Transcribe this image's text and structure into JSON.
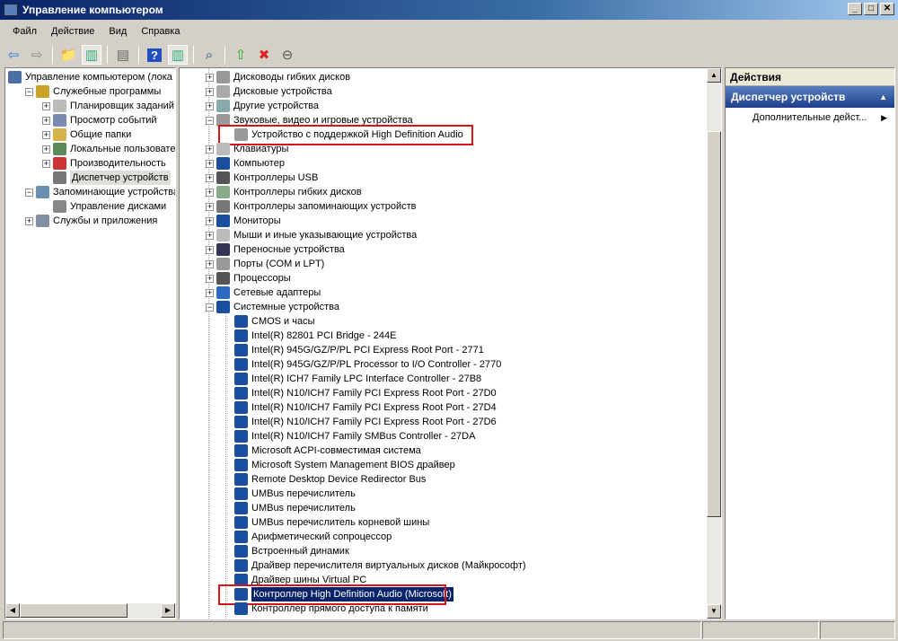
{
  "window": {
    "title": "Управление компьютером",
    "min": "_",
    "max": "□",
    "close": "✕"
  },
  "menu": [
    "Файл",
    "Действие",
    "Вид",
    "Справка"
  ],
  "toolbar": [
    {
      "icon": "back-icon",
      "glyph": "⇦",
      "color": "#2a7de1"
    },
    {
      "icon": "forward-icon",
      "glyph": "⇨",
      "color": "#888"
    },
    {
      "sep": true
    },
    {
      "icon": "up-folder-icon",
      "glyph": "📁",
      "color": "#c9a227"
    },
    {
      "icon": "show-hide-tree-icon",
      "glyph": "▥",
      "color": "#3a7",
      "on": true
    },
    {
      "sep": true
    },
    {
      "icon": "properties-icon",
      "glyph": "▤",
      "color": "#666"
    },
    {
      "sep": true
    },
    {
      "icon": "help-icon",
      "glyph": "?",
      "color": "#fff",
      "bg": "#2050c0"
    },
    {
      "icon": "show-hide-action-pane-icon",
      "glyph": "▥",
      "color": "#3a7",
      "on": true
    },
    {
      "sep": true
    },
    {
      "icon": "scan-hardware-icon",
      "glyph": "⌕",
      "color": "#246"
    },
    {
      "sep": true
    },
    {
      "icon": "update-driver-icon",
      "glyph": "⇧",
      "color": "#2a2"
    },
    {
      "icon": "uninstall-icon",
      "glyph": "✖",
      "color": "#d22"
    },
    {
      "icon": "disable-icon",
      "glyph": "⊖",
      "color": "#555"
    }
  ],
  "left_tree": [
    {
      "level": 0,
      "exp": "",
      "label": "Управление компьютером (лока",
      "color": "#4a6fa5"
    },
    {
      "level": 1,
      "exp": "−",
      "label": "Служебные программы",
      "color": "#c9a227"
    },
    {
      "level": 2,
      "exp": "+",
      "label": "Планировщик заданий",
      "color": "#bbb"
    },
    {
      "level": 2,
      "exp": "+",
      "label": "Просмотр событий",
      "color": "#7a8ab0"
    },
    {
      "level": 2,
      "exp": "+",
      "label": "Общие папки",
      "color": "#d8b24a"
    },
    {
      "level": 2,
      "exp": "+",
      "label": "Локальные пользовател",
      "color": "#5a8a5a"
    },
    {
      "level": 2,
      "exp": "+",
      "label": "Производительность",
      "color": "#c33"
    },
    {
      "level": 2,
      "exp": "",
      "label": "Диспетчер устройств",
      "color": "#777",
      "hl": true
    },
    {
      "level": 1,
      "exp": "−",
      "label": "Запоминающие устройства",
      "color": "#6a8fb0"
    },
    {
      "level": 2,
      "exp": "",
      "label": "Управление дисками",
      "color": "#888"
    },
    {
      "level": 1,
      "exp": "+",
      "label": "Службы и приложения",
      "color": "#8090a0"
    }
  ],
  "device_tree": [
    {
      "level": 1,
      "exp": "+",
      "label": "Дисководы гибких дисков",
      "color": "#999"
    },
    {
      "level": 1,
      "exp": "+",
      "label": "Дисковые устройства",
      "color": "#aaa"
    },
    {
      "level": 1,
      "exp": "+",
      "label": "Другие устройства",
      "color": "#8aa"
    },
    {
      "level": 1,
      "exp": "−",
      "label": "Звуковые, видео и игровые устройства",
      "color": "#999"
    },
    {
      "level": 2,
      "exp": "",
      "label": "Устройство с поддержкой High Definition Audio",
      "color": "#999",
      "boxed": true
    },
    {
      "level": 1,
      "exp": "+",
      "label": "Клавиатуры",
      "color": "#bbb"
    },
    {
      "level": 1,
      "exp": "+",
      "label": "Компьютер",
      "color": "#1a4fa0"
    },
    {
      "level": 1,
      "exp": "+",
      "label": "Контроллеры USB",
      "color": "#555"
    },
    {
      "level": 1,
      "exp": "+",
      "label": "Контроллеры гибких дисков",
      "color": "#8a8"
    },
    {
      "level": 1,
      "exp": "+",
      "label": "Контроллеры запоминающих устройств",
      "color": "#777"
    },
    {
      "level": 1,
      "exp": "+",
      "label": "Мониторы",
      "color": "#1a4fa0"
    },
    {
      "level": 1,
      "exp": "+",
      "label": "Мыши и иные указывающие устройства",
      "color": "#bbb"
    },
    {
      "level": 1,
      "exp": "+",
      "label": "Переносные устройства",
      "color": "#335"
    },
    {
      "level": 1,
      "exp": "+",
      "label": "Порты (COM и LPT)",
      "color": "#999"
    },
    {
      "level": 1,
      "exp": "+",
      "label": "Процессоры",
      "color": "#555"
    },
    {
      "level": 1,
      "exp": "+",
      "label": "Сетевые адаптеры",
      "color": "#2a6ac0"
    },
    {
      "level": 1,
      "exp": "−",
      "label": "Системные устройства",
      "color": "#1a4fa0"
    },
    {
      "level": 2,
      "exp": "",
      "label": "CMOS и часы",
      "color": "#1a4fa0"
    },
    {
      "level": 2,
      "exp": "",
      "label": "Intel(R) 82801 PCI Bridge - 244E",
      "color": "#1a4fa0"
    },
    {
      "level": 2,
      "exp": "",
      "label": "Intel(R) 945G/GZ/P/PL PCI Express Root Port - 2771",
      "color": "#1a4fa0"
    },
    {
      "level": 2,
      "exp": "",
      "label": "Intel(R) 945G/GZ/P/PL Processor to I/O Controller - 2770",
      "color": "#1a4fa0"
    },
    {
      "level": 2,
      "exp": "",
      "label": "Intel(R) ICH7 Family LPC Interface Controller - 27B8",
      "color": "#1a4fa0"
    },
    {
      "level": 2,
      "exp": "",
      "label": "Intel(R) N10/ICH7 Family PCI Express Root Port - 27D0",
      "color": "#1a4fa0"
    },
    {
      "level": 2,
      "exp": "",
      "label": "Intel(R) N10/ICH7 Family PCI Express Root Port - 27D4",
      "color": "#1a4fa0"
    },
    {
      "level": 2,
      "exp": "",
      "label": "Intel(R) N10/ICH7 Family PCI Express Root Port - 27D6",
      "color": "#1a4fa0"
    },
    {
      "level": 2,
      "exp": "",
      "label": "Intel(R) N10/ICH7 Family SMBus Controller - 27DA",
      "color": "#1a4fa0"
    },
    {
      "level": 2,
      "exp": "",
      "label": "Microsoft ACPI-совместимая система",
      "color": "#1a4fa0"
    },
    {
      "level": 2,
      "exp": "",
      "label": "Microsoft System Management BIOS драйвер",
      "color": "#1a4fa0"
    },
    {
      "level": 2,
      "exp": "",
      "label": "Remote Desktop Device Redirector Bus",
      "color": "#1a4fa0"
    },
    {
      "level": 2,
      "exp": "",
      "label": "UMBus перечислитель",
      "color": "#1a4fa0"
    },
    {
      "level": 2,
      "exp": "",
      "label": "UMBus перечислитель",
      "color": "#1a4fa0"
    },
    {
      "level": 2,
      "exp": "",
      "label": "UMBus перечислитель корневой шины",
      "color": "#1a4fa0"
    },
    {
      "level": 2,
      "exp": "",
      "label": "Арифметический сопроцессор",
      "color": "#1a4fa0"
    },
    {
      "level": 2,
      "exp": "",
      "label": "Встроенный динамик",
      "color": "#1a4fa0"
    },
    {
      "level": 2,
      "exp": "",
      "label": "Драйвер перечислителя виртуальных дисков (Майкрософт)",
      "color": "#1a4fa0"
    },
    {
      "level": 2,
      "exp": "",
      "label": "Драйвер шины Virtual PC",
      "color": "#1a4fa0"
    },
    {
      "level": 2,
      "exp": "",
      "label": "Контроллер High Definition Audio (Microsoft)",
      "color": "#1a4fa0",
      "selected": true,
      "boxed": true
    },
    {
      "level": 2,
      "exp": "",
      "label": "Контроллер прямого доступа к памяти",
      "color": "#1a4fa0"
    }
  ],
  "actions": {
    "header": "Действия",
    "section": "Диспетчер устройств",
    "collapse": "▲",
    "item": "Дополнительные дейст...",
    "item_arrow": "▶"
  },
  "scroll": {
    "up": "▲",
    "down": "▼",
    "left": "◀",
    "right": "▶"
  }
}
